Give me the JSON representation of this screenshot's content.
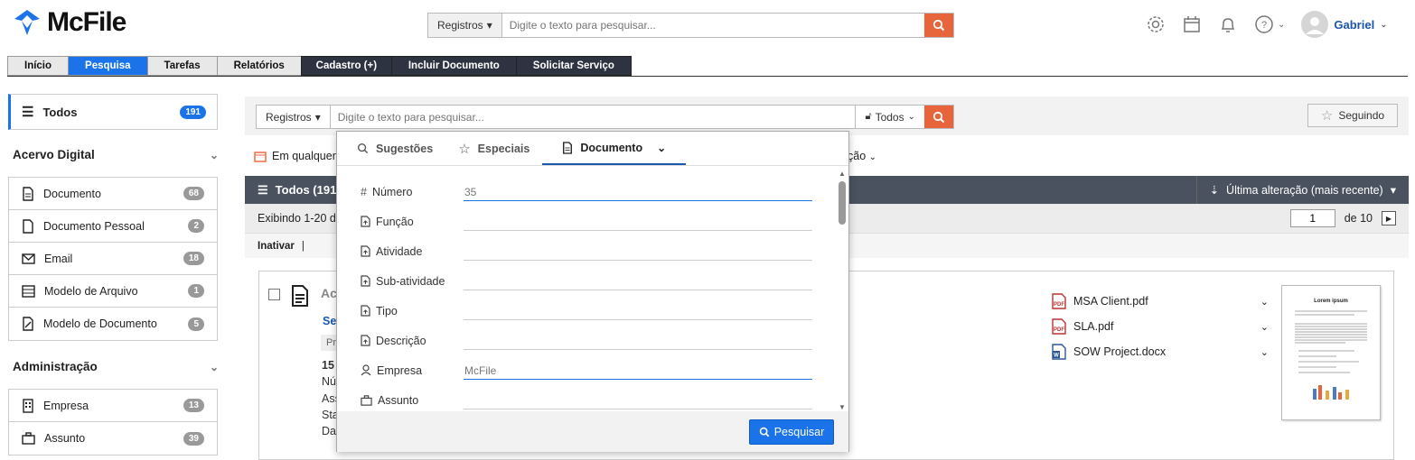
{
  "app": {
    "name": "McFile"
  },
  "header": {
    "search_scope": "Registros",
    "search_placeholder": "Digite o texto para pesquisar...",
    "user": "Gabriel"
  },
  "tabs": [
    "Início",
    "Pesquisa",
    "Tarefas",
    "Relatórios",
    "Cadastro (+)",
    "Incluir Documento",
    "Solicitar Serviço"
  ],
  "sidebar": {
    "all": {
      "label": "Todos",
      "count": "191"
    },
    "sections": [
      {
        "title": "Acervo Digital",
        "items": [
          {
            "label": "Documento",
            "count": "68",
            "icon": "document-icon"
          },
          {
            "label": "Documento Pessoal",
            "count": "2",
            "icon": "file-icon"
          },
          {
            "label": "Email",
            "count": "18",
            "icon": "mail-icon"
          },
          {
            "label": "Modelo de Arquivo",
            "count": "1",
            "icon": "list-icon"
          },
          {
            "label": "Modelo de Documento",
            "count": "5",
            "icon": "template-icon"
          }
        ]
      },
      {
        "title": "Administração",
        "items": [
          {
            "label": "Empresa",
            "count": "13",
            "icon": "building-icon"
          },
          {
            "label": "Assunto",
            "count": "39",
            "icon": "briefcase-icon"
          }
        ]
      }
    ]
  },
  "main": {
    "search_scope": "Registros",
    "search_placeholder": "Digite o texto para pesquisar...",
    "visibility": "Todos",
    "follow": "Seguindo",
    "date_filter": "Em qualquer",
    "sort_filter_tail": "ção",
    "list_title": "Todos (191",
    "sort_label": "Última alteração (mais recente)",
    "showing": "Exibindo 1-20 de",
    "page": "1",
    "page_total": "de 10",
    "action": "Inativar",
    "card": {
      "title_partial": "Ac",
      "link_partial": "Se",
      "chip_partial": "Pr",
      "lines": [
        "15",
        "Nú",
        "Ass",
        "Sta",
        "Dat"
      ]
    },
    "attachments": [
      {
        "name": "MSA Client.pdf",
        "type": "pdf"
      },
      {
        "name": "SLA.pdf",
        "type": "pdf"
      },
      {
        "name": "SOW Project.docx",
        "type": "docx"
      }
    ],
    "thumbnail_title": "Lorem ipsum"
  },
  "panel": {
    "tabs": [
      "Sugestões",
      "Especiais",
      "Documento"
    ],
    "fields": [
      {
        "label": "Número",
        "value": "35",
        "icon": "hash-icon"
      },
      {
        "label": "Função",
        "value": "",
        "icon": "file-up-icon"
      },
      {
        "label": "Atividade",
        "value": "",
        "icon": "file-up-icon"
      },
      {
        "label": "Sub-atividade",
        "value": "",
        "icon": "file-up-icon"
      },
      {
        "label": "Tipo",
        "value": "",
        "icon": "file-up-icon"
      },
      {
        "label": "Descrição",
        "value": "",
        "icon": "file-up-icon"
      },
      {
        "label": "Empresa",
        "value": "McFile",
        "icon": "person-icon"
      },
      {
        "label": "Assunto",
        "value": "",
        "icon": "briefcase-icon"
      }
    ],
    "submit": "Pesquisar"
  },
  "colors": {
    "accent": "#1a73e8",
    "search": "#e8643a",
    "dark": "#2d3340"
  }
}
